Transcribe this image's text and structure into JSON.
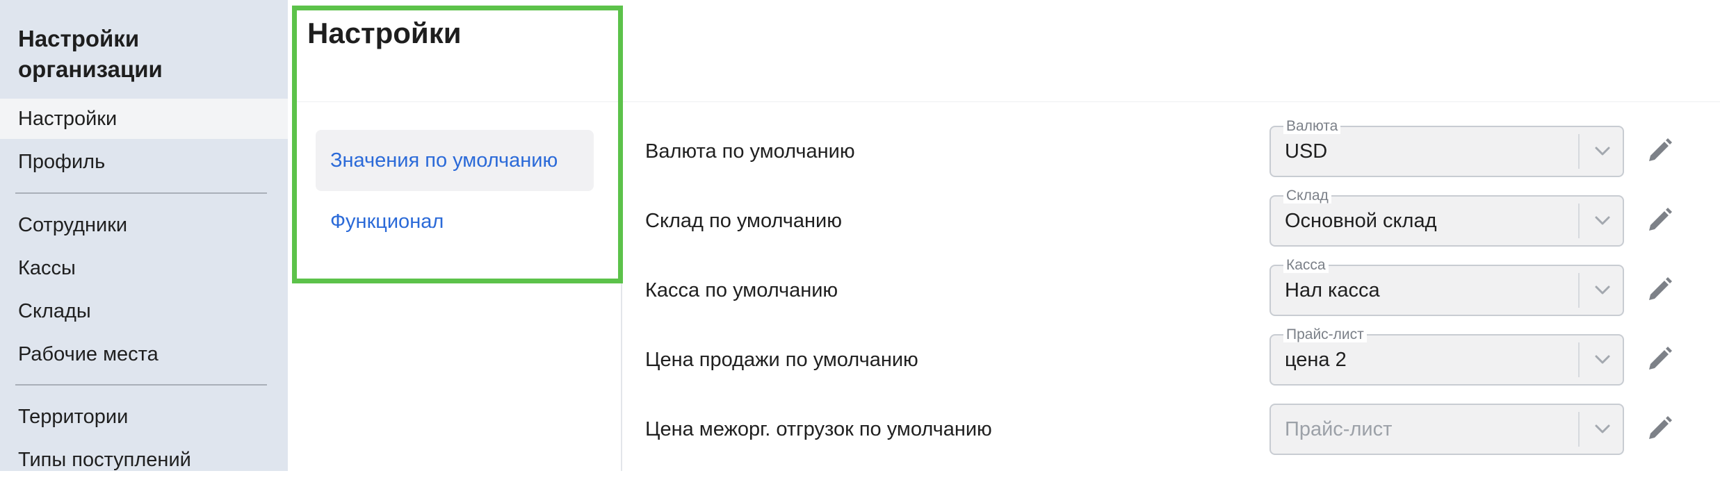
{
  "sidebar": {
    "title": "Настройки организации",
    "items": [
      {
        "label": "Настройки",
        "active": true
      },
      {
        "label": "Профиль"
      },
      {
        "label": "Сотрудники"
      },
      {
        "label": "Кассы"
      },
      {
        "label": "Склады"
      },
      {
        "label": "Рабочие места"
      },
      {
        "label": "Территории"
      },
      {
        "label": "Типы поступлений"
      }
    ]
  },
  "page": {
    "title": "Настройки"
  },
  "subnav": {
    "items": [
      {
        "label": "Значения по умолчанию",
        "active": true
      },
      {
        "label": "Функционал"
      }
    ]
  },
  "defaults": {
    "rows": [
      {
        "label": "Валюта по умолчанию",
        "field_label": "Валюта",
        "value": "USD"
      },
      {
        "label": "Склад по умолчанию",
        "field_label": "Склад",
        "value": "Основной склад"
      },
      {
        "label": "Касса по умолчанию",
        "field_label": "Касса",
        "value": "Нал касса"
      },
      {
        "label": "Цена продажи по умолчанию",
        "field_label": "Прайс-лист",
        "value": "цена 2"
      },
      {
        "label": "Цена межорг. отгрузок по умолчанию",
        "field_label": "",
        "value": "",
        "placeholder": "Прайс-лист"
      }
    ]
  },
  "colors": {
    "highlight_frame": "#5cc24a",
    "link": "#2b6ad8",
    "sidebar_bg": "#dfe5ee"
  },
  "icons": {
    "select_chevron": "chevron-down-icon",
    "edit": "pencil-icon"
  }
}
